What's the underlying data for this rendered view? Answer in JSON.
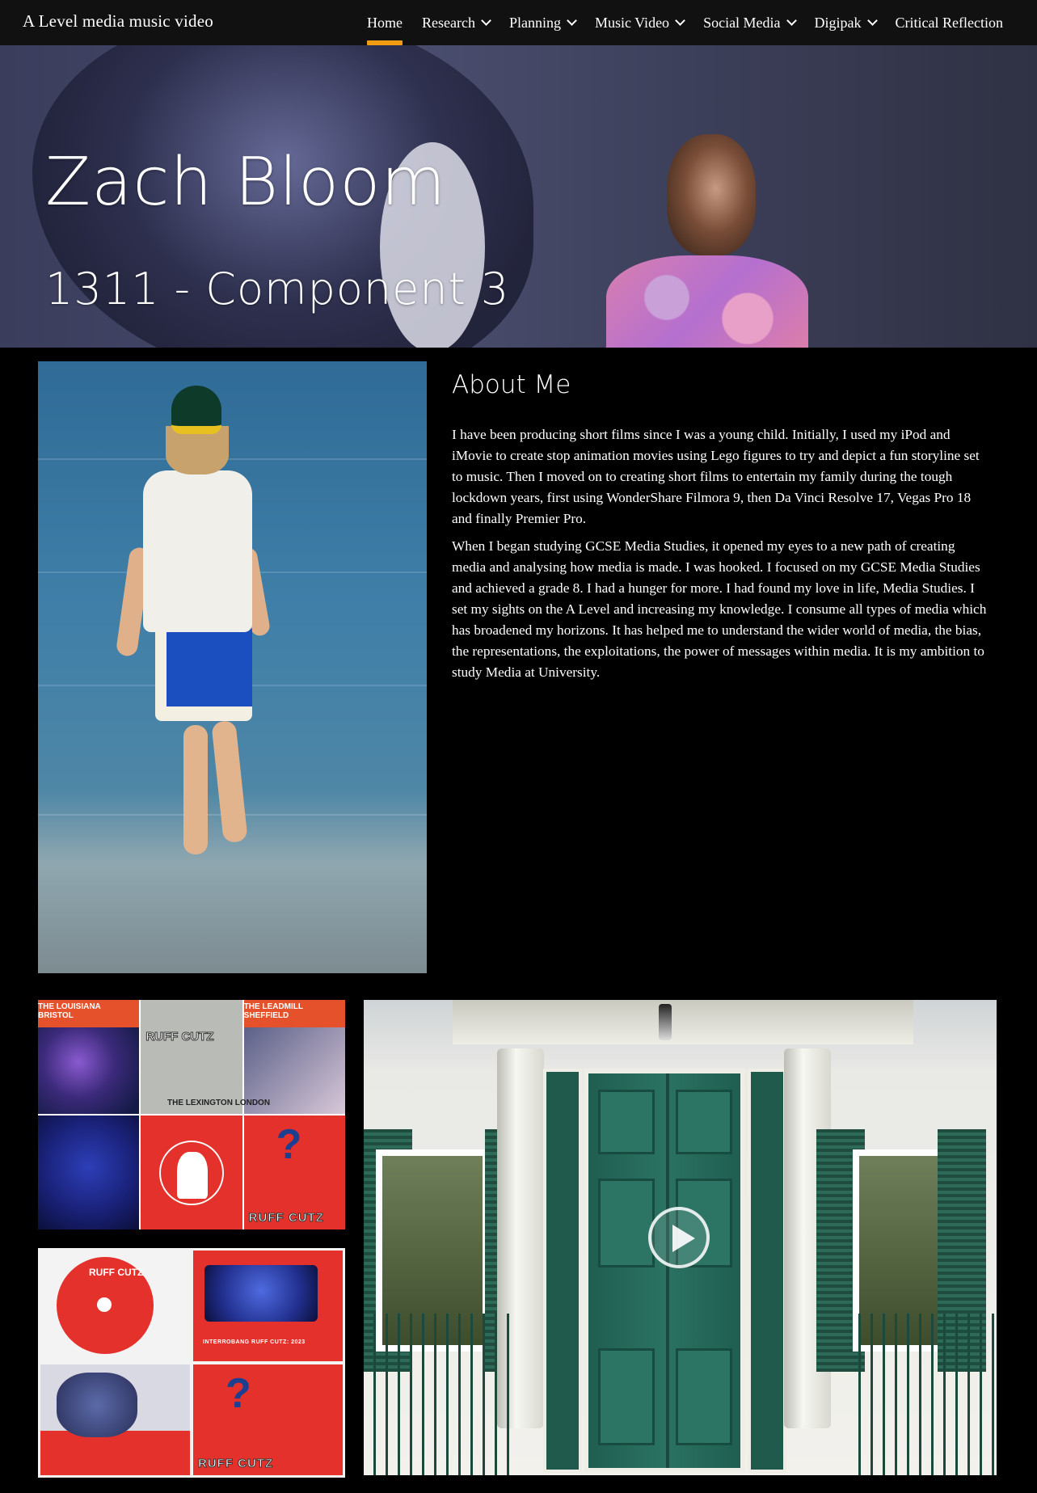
{
  "site": {
    "title": "A Level media music video"
  },
  "nav": {
    "items": [
      {
        "label": "Home",
        "active": true,
        "dropdown": false
      },
      {
        "label": "Research",
        "active": false,
        "dropdown": true
      },
      {
        "label": "Planning",
        "active": false,
        "dropdown": true
      },
      {
        "label": "Music Video",
        "active": false,
        "dropdown": true
      },
      {
        "label": "Social Media",
        "active": false,
        "dropdown": true
      },
      {
        "label": "Digipak",
        "active": false,
        "dropdown": true
      },
      {
        "label": "Critical Reflection",
        "active": false,
        "dropdown": false
      }
    ]
  },
  "hero": {
    "title": "Zach Bloom",
    "subtitle": "1311 - Component 3"
  },
  "about": {
    "heading": "About Me",
    "paragraphs": [
      "I have been producing short films since I was a young child. Initially, I used my iPod and iMovie to create stop animation movies using Lego figures to try and depict a fun storyline set to music. Then I moved on to creating short films to entertain my family during the tough lockdown years, first using WonderShare Filmora 9, then Da Vinci Resolve 17, Vegas Pro 18 and finally Premier Pro.",
      "When I began studying GCSE Media Studies, it opened my eyes to a new path of creating media and analysing how media is made. I was hooked. I focused on my GCSE Media Studies and achieved a grade 8. I had a hunger for more. I had found my love in life, Media Studies. I set my sights on the A Level and increasing my knowledge. I consume all types of media which has broadened my horizons. It has helped me to understand the wider world of media, the bias, the representations, the exploitations, the power of messages within media. It is my ambition to study Media at University."
    ]
  },
  "gallery": {
    "poster_labels": [
      "THE LOUISIANA BRISTOL",
      "RUFF CUTZ",
      "THE LEADMILL SHEFFIELD",
      "THE LEXINGTON LONDON",
      "RUFF CUTZ"
    ],
    "digipak_labels": [
      "RUFF CUTZ",
      "INTERROBANG RUFF CUTZ: 2023",
      "RUFF CUTZ"
    ]
  },
  "colors": {
    "accent": "#f39c12",
    "nav_bg": "#111111",
    "page_bg": "#000000"
  }
}
